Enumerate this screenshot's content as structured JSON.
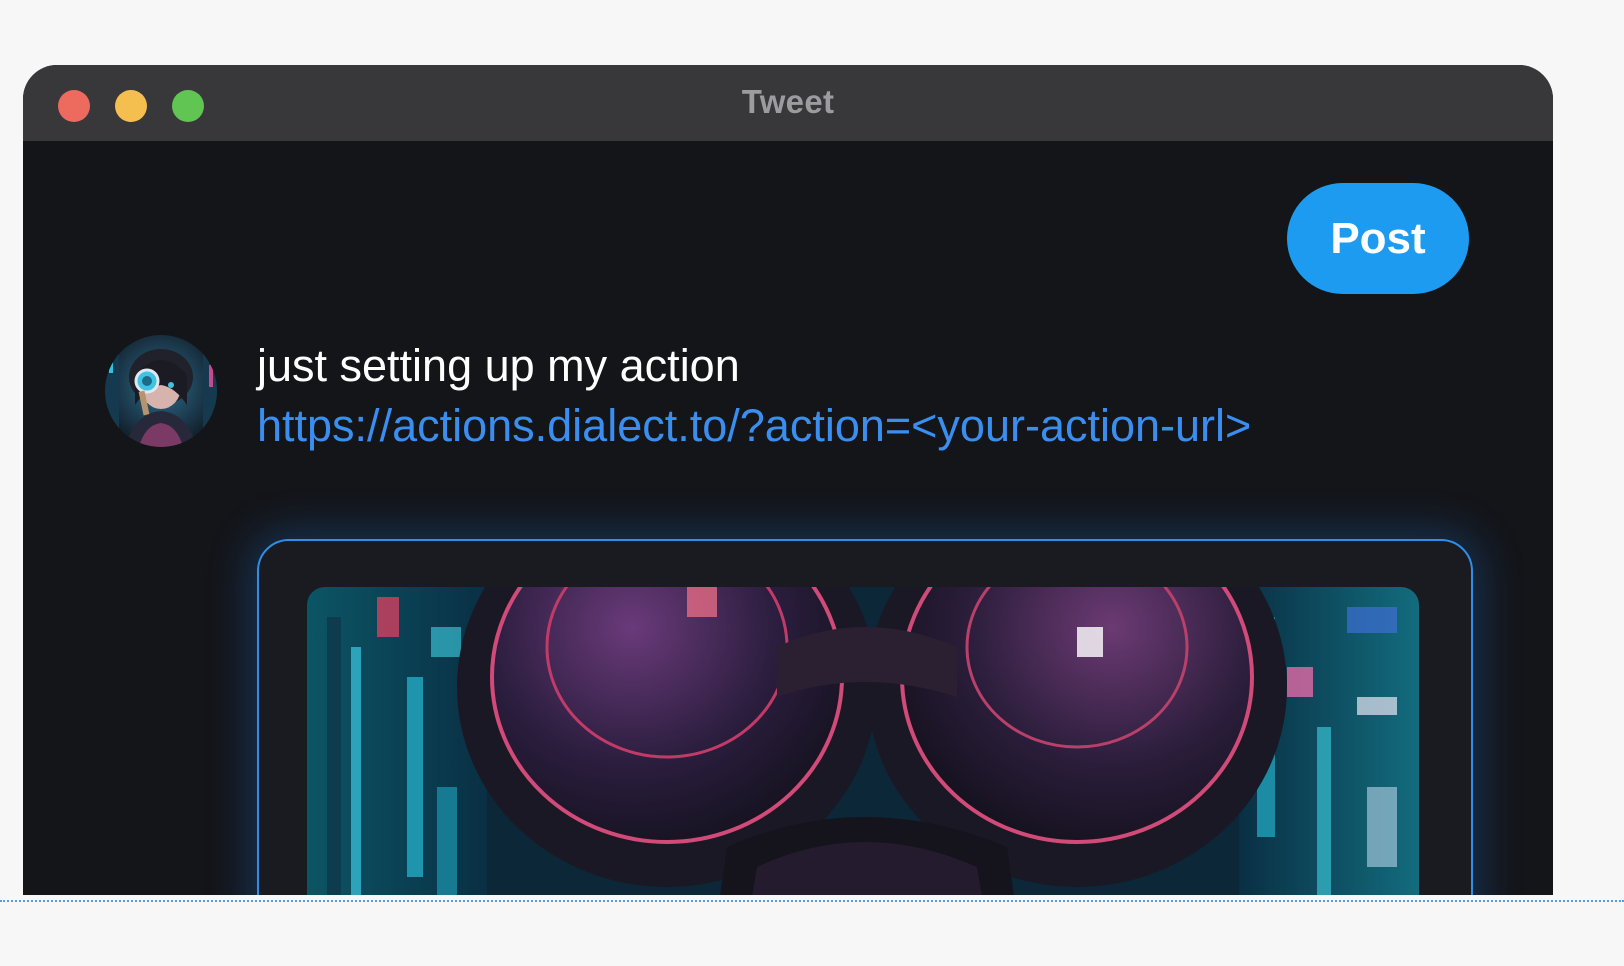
{
  "window": {
    "title": "Tweet"
  },
  "composer": {
    "post_label": "Post",
    "text": "just setting up my action",
    "link": "https://actions.dialect.to/?action=<your-action-url>"
  },
  "icons": {
    "avatar": "avatar-image",
    "card": "cyberpunk-goggles-image"
  },
  "colors": {
    "accent": "#1d9bf0",
    "link": "#3a8ef0",
    "background": "#141519",
    "titlebar": "#38383b",
    "card_border": "#2f8ee8"
  }
}
